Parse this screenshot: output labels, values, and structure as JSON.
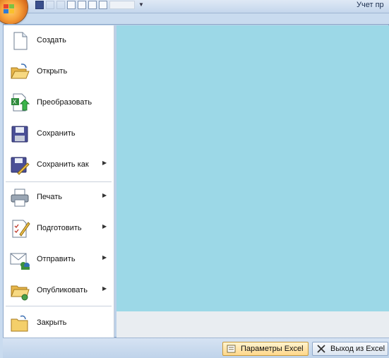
{
  "title_bar": {
    "text": "Учет пр"
  },
  "menu": {
    "items": [
      {
        "label": "Создать",
        "icon": "new-document-icon",
        "submenu": false
      },
      {
        "label": "Открыть",
        "icon": "open-folder-icon",
        "submenu": false
      },
      {
        "label": "Преобразовать",
        "icon": "convert-icon",
        "submenu": false
      },
      {
        "label": "Сохранить",
        "icon": "save-icon",
        "submenu": false
      },
      {
        "label": "Сохранить как",
        "icon": "save-as-icon",
        "submenu": true
      },
      {
        "label": "Печать",
        "icon": "printer-icon",
        "submenu": true
      },
      {
        "label": "Подготовить",
        "icon": "prepare-icon",
        "submenu": true
      },
      {
        "label": "Отправить",
        "icon": "send-icon",
        "submenu": true
      },
      {
        "label": "Опубликовать",
        "icon": "publish-icon",
        "submenu": true
      },
      {
        "label": "Закрыть",
        "icon": "close-folder-icon",
        "submenu": false
      }
    ]
  },
  "footer": {
    "options_label": "Параметры Excel",
    "exit_label": "Выход из Excel"
  },
  "colors": {
    "right_panel": "#9cd8e7",
    "orb": "#f7a23b",
    "highlight_button": "#ffd78a"
  }
}
